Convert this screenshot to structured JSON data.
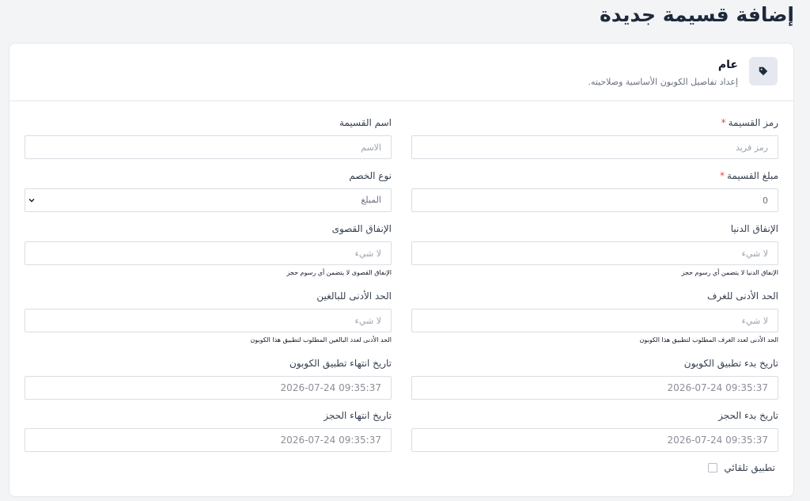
{
  "page": {
    "title": "إضافة قسيمة جديدة"
  },
  "section": {
    "icon": "tag-icon",
    "title": "عام",
    "subtitle": "إعداد تفاصيل الكوبون الأساسية وصلاحيته."
  },
  "fields": {
    "code": {
      "label": "رمز القسيمة",
      "required": "*",
      "placeholder": "رمز فريد"
    },
    "name": {
      "label": "اسم القسيمة",
      "placeholder": "الاسم"
    },
    "amount": {
      "label": "مبلغ القسيمة",
      "required": "*",
      "value": "0"
    },
    "discount_type": {
      "label": "نوع الخصم",
      "value": "المبلغ"
    },
    "min_spend": {
      "label": "الإنفاق الدنيا",
      "placeholder": "لا شيء",
      "help": "الإنفاق الدنيا لا يتضمن أي رسوم حجز"
    },
    "max_spend": {
      "label": "الإنفاق القصوى",
      "placeholder": "لا شيء",
      "help": "الإنفاق القصوى لا يتضمن أي رسوم حجز"
    },
    "min_rooms": {
      "label": "الحد الأدنى للغرف",
      "placeholder": "لا شيء",
      "help": "الحد الأدنى لعدد الغرف المطلوب لتطبيق هذا الكوبون"
    },
    "min_adults": {
      "label": "الحد الأدنى للبالغين",
      "placeholder": "لا شيء",
      "help": "الحد الأدنى لعدد البالغين المطلوب لتطبيق هذا الكوبون"
    },
    "coupon_start": {
      "label": "تاريخ بدء تطبيق الكوبون",
      "value": "2026-07-24 09:35:37"
    },
    "coupon_end": {
      "label": "تاريخ انتهاء تطبيق الكوبون",
      "value": "2026-07-24 09:35:37"
    },
    "booking_start": {
      "label": "تاريخ بدء الحجز",
      "value": "2026-07-24 09:35:37"
    },
    "booking_end": {
      "label": "تاريخ انتهاء الحجز",
      "value": "2026-07-24 09:35:37"
    }
  },
  "auto_apply": {
    "label": "تطبيق تلقائي",
    "checked": false
  },
  "colors": {
    "required": "#ef4444",
    "title": "#1e293b",
    "icon_bg": "#e5e9ef"
  }
}
